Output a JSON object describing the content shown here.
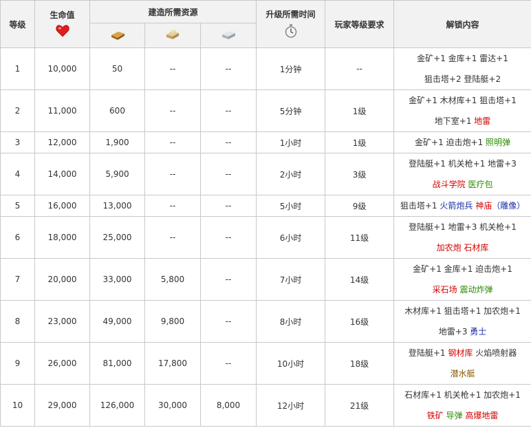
{
  "headers": {
    "level": "等级",
    "hp": "生命值",
    "resources": "建造所需资源",
    "time": "升级所需时间",
    "req": "玩家等级要求",
    "unlock": "解锁内容"
  },
  "icons": {
    "hp": "heart-icon",
    "gold": "gold-bar-icon",
    "wood": "wood-icon",
    "stone": "stone-icon",
    "time": "stopwatch-icon"
  },
  "colors": {
    "red": "#d40000",
    "green": "#2a8a00",
    "blue": "#1a2fa8",
    "brown": "#8b5a00"
  },
  "rows": [
    {
      "level": "1",
      "hp": "10,000",
      "gold": "50",
      "wood": "--",
      "stone": "--",
      "time": "1分钟",
      "req": "--",
      "unlock": [
        [
          {
            "t": "金矿+1 金库+1 雷达+1",
            "c": ""
          }
        ],
        [
          {
            "t": "狙击塔+2 登陆艇+2",
            "c": ""
          }
        ]
      ]
    },
    {
      "level": "2",
      "hp": "11,000",
      "gold": "600",
      "wood": "--",
      "stone": "--",
      "time": "5分钟",
      "req": "1级",
      "unlock": [
        [
          {
            "t": "金矿+1 木材库+1 狙击塔+1",
            "c": ""
          }
        ],
        [
          {
            "t": "地下室+1 ",
            "c": ""
          },
          {
            "t": "地雷",
            "c": "red"
          }
        ]
      ]
    },
    {
      "level": "3",
      "hp": "12,000",
      "gold": "1,900",
      "wood": "--",
      "stone": "--",
      "time": "1小时",
      "req": "1级",
      "unlock": [
        [
          {
            "t": "金矿+1 迫击炮+1 ",
            "c": ""
          },
          {
            "t": "照明弹",
            "c": "green"
          }
        ]
      ]
    },
    {
      "level": "4",
      "hp": "14,000",
      "gold": "5,900",
      "wood": "--",
      "stone": "--",
      "time": "2小时",
      "req": "3级",
      "unlock": [
        [
          {
            "t": "登陆艇+1 机关枪+1 地雷+3",
            "c": ""
          }
        ],
        [
          {
            "t": "战斗学院 ",
            "c": "red"
          },
          {
            "t": "医疗包",
            "c": "green"
          }
        ]
      ]
    },
    {
      "level": "5",
      "hp": "16,000",
      "gold": "13,000",
      "wood": "--",
      "stone": "--",
      "time": "5小时",
      "req": "9级",
      "unlock": [
        [
          {
            "t": "狙击塔+1 ",
            "c": ""
          },
          {
            "t": "火箭炮兵 ",
            "c": "blue"
          },
          {
            "t": "神庙",
            "c": "red"
          },
          {
            "t": "（雕像）",
            "c": "blue"
          }
        ]
      ]
    },
    {
      "level": "6",
      "hp": "18,000",
      "gold": "25,000",
      "wood": "--",
      "stone": "--",
      "time": "6小时",
      "req": "11级",
      "unlock": [
        [
          {
            "t": "登陆艇+1 地雷+3 机关枪+1",
            "c": ""
          }
        ],
        [
          {
            "t": "加农炮 石材库",
            "c": "red"
          }
        ]
      ]
    },
    {
      "level": "7",
      "hp": "20,000",
      "gold": "33,000",
      "wood": "5,800",
      "stone": "--",
      "time": "7小时",
      "req": "14级",
      "unlock": [
        [
          {
            "t": "金矿+1 金库+1 迫击炮+1",
            "c": ""
          }
        ],
        [
          {
            "t": "采石场 ",
            "c": "red"
          },
          {
            "t": "震动炸弹",
            "c": "green"
          }
        ]
      ]
    },
    {
      "level": "8",
      "hp": "23,000",
      "gold": "49,000",
      "wood": "9,800",
      "stone": "--",
      "time": "8小时",
      "req": "16级",
      "unlock": [
        [
          {
            "t": "木材库+1 狙击塔+1 加农炮+1",
            "c": ""
          }
        ],
        [
          {
            "t": "地雷+3 ",
            "c": ""
          },
          {
            "t": "勇士",
            "c": "blue"
          }
        ]
      ]
    },
    {
      "level": "9",
      "hp": "26,000",
      "gold": "81,000",
      "wood": "17,800",
      "stone": "--",
      "time": "10小时",
      "req": "18级",
      "unlock": [
        [
          {
            "t": "登陆艇+1 ",
            "c": ""
          },
          {
            "t": "钢材库 ",
            "c": "red"
          },
          {
            "t": "火焰喷射器",
            "c": ""
          }
        ],
        [
          {
            "t": "潜水艇",
            "c": "brown"
          }
        ]
      ]
    },
    {
      "level": "10",
      "hp": "29,000",
      "gold": "126,000",
      "wood": "30,000",
      "stone": "8,000",
      "time": "12小时",
      "req": "21级",
      "unlock": [
        [
          {
            "t": "石材库+1 机关枪+1 加农炮+1",
            "c": ""
          }
        ],
        [
          {
            "t": "铁矿 ",
            "c": "red"
          },
          {
            "t": "导弹 ",
            "c": "green"
          },
          {
            "t": "高爆地雷",
            "c": "red"
          }
        ]
      ]
    }
  ]
}
